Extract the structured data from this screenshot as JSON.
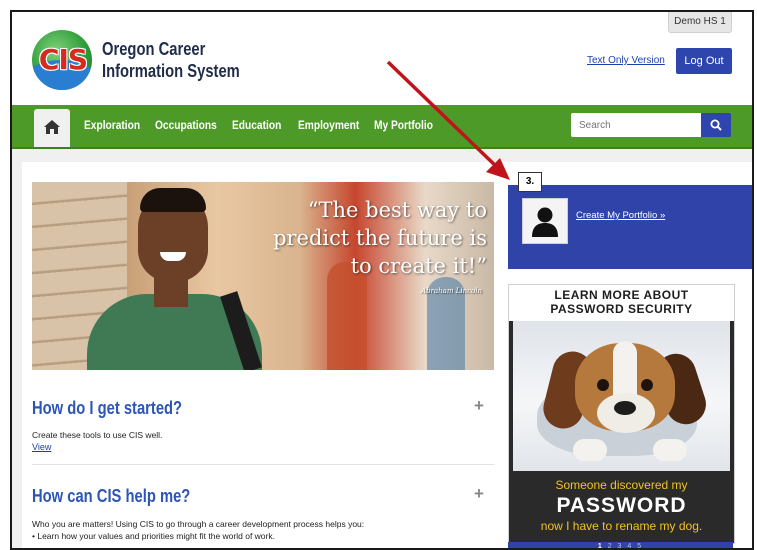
{
  "header": {
    "demo_tag": "Demo HS 1",
    "logo_letters": "CIS",
    "title_line1": "Oregon Career",
    "title_line2": "Information System",
    "text_only_link": "Text Only Version",
    "logout_label": "Log Out"
  },
  "nav": {
    "items": [
      {
        "label": "Exploration"
      },
      {
        "label": "Occupations"
      },
      {
        "label": "Education"
      },
      {
        "label": "Employment"
      },
      {
        "label": "My Portfolio"
      }
    ],
    "search_placeholder": "Search"
  },
  "hero": {
    "quote": "“The best way to predict the future is to create it!”",
    "author": "Abraham Lincoln"
  },
  "sections": [
    {
      "title": "How do I get started?",
      "text": "Create these tools to use CIS well.",
      "link": "View"
    },
    {
      "title": "How can CIS help me?",
      "text": "Who you are matters! Using CIS to go through a career development process helps you:",
      "bullet": "• Learn how your values and priorities might fit the world of work."
    }
  ],
  "sidebar": {
    "step_badge": "3.",
    "portfolio_link": "Create My Portfolio »",
    "ad": {
      "header_line1": "LEARN MORE ABOUT",
      "header_line2": "PASSWORD SECURITY",
      "line1": "Someone discovered my",
      "line2": "PASSWORD",
      "line3": "now I have to rename my dog.",
      "pager_current": "1",
      "pager_rest": "2 3 4 5"
    }
  },
  "colors": {
    "nav_green": "#4d9a29",
    "primary_blue": "#2e45ad",
    "heading_blue": "#2d55b8",
    "annotation_red": "#c0141c"
  }
}
